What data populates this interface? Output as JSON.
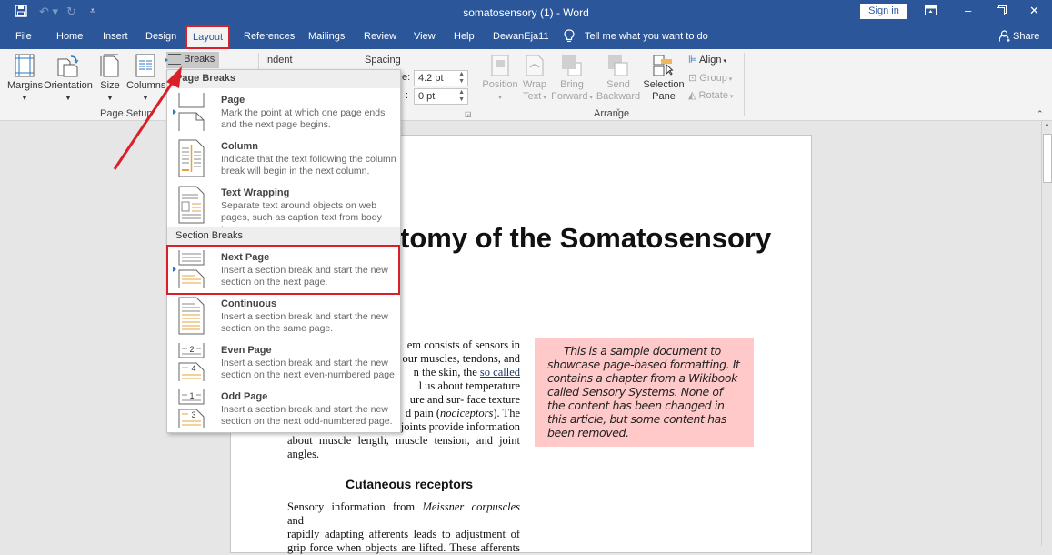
{
  "titlebar": {
    "title": "somatosensory (1)  -  Word",
    "signin_label": "Sign in",
    "icons": [
      "save-icon",
      "undo-icon",
      "redo-icon",
      "customize-qat-icon",
      "ribbon-display-icon",
      "minimize-icon",
      "restore-icon",
      "close-icon"
    ]
  },
  "tabs": {
    "items": [
      "File",
      "Home",
      "Insert",
      "Design",
      "Layout",
      "References",
      "Mailings",
      "Review",
      "View",
      "Help",
      "DewanEja11"
    ],
    "active": "Layout",
    "tell_me": "Tell me what you want to do",
    "share": "Share"
  },
  "ribbon": {
    "page_setup": {
      "margins": "Margins",
      "orientation": "Orientation",
      "size": "Size",
      "columns": "Columns",
      "breaks": "Breaks",
      "group_label": "Page Setup"
    },
    "paragraph": {
      "indent": "Indent",
      "spacing": "Spacing",
      "before_label": "e:",
      "before_value": "4.2 pt",
      "after_label": ":",
      "after_value": "0 pt"
    },
    "arrange": {
      "position": "Position",
      "wrap_text_1": "Wrap",
      "wrap_text_2": "Text",
      "bring_forward_1": "Bring",
      "bring_forward_2": "Forward",
      "send_backward_1": "Send",
      "send_backward_2": "Backward",
      "selection_pane_1": "Selection",
      "selection_pane_2": "Pane",
      "align": "Align",
      "group": "Group",
      "rotate": "Rotate",
      "group_label": "Arrange"
    }
  },
  "breaks_menu": {
    "page_breaks_header": "Page Breaks",
    "section_breaks_header": "Section Breaks",
    "items": [
      {
        "label": "Page",
        "desc": "Mark the point at which one page ends and the next page begins."
      },
      {
        "label": "Column",
        "desc": "Indicate that the text following the column break will begin in the next column."
      },
      {
        "label": "Text Wrapping",
        "desc": "Separate text around objects on web pages, such as caption text from body text."
      },
      {
        "label": "Next Page",
        "desc": "Insert a section break and start the new section on the next page."
      },
      {
        "label": "Continuous",
        "desc": "Insert a section break and start the new section on the same page."
      },
      {
        "label": "Even Page",
        "desc": "Insert a section break and start the new section on the next even-numbered page."
      },
      {
        "label": "Odd Page",
        "desc": "Insert a section break and start the new section on the next odd-numbered page."
      }
    ],
    "highlighted": "Next Page"
  },
  "document": {
    "title_visible": "tomy of the Somatosensory",
    "para1_lines": [
      "em consists of sensors in",
      "our muscles, tendons, and",
      "n the skin, the so called",
      "l us about temperature",
      "ure and sur- face texture",
      "d pain (nociceptors). The",
      "joints provide information",
      "about muscle length, muscle tension, and joint",
      "angles."
    ],
    "sidebar_note": "This is a sample document to showcase page-based formatting. It contains a chapter from a Wikibook called Sensory Systems. None of the content has been changed in this article, but some content has been removed.",
    "heading2": "Cutaneous receptors",
    "para2_lines": [
      "Sensory information from Meissner corpuscles and",
      "rapidly adapting afferents leads to adjustment of",
      "grip force when objects are lifted. These afferents"
    ]
  },
  "annotation": {
    "arrow_color": "#d9202a",
    "highlight_color": "#d9202a"
  }
}
